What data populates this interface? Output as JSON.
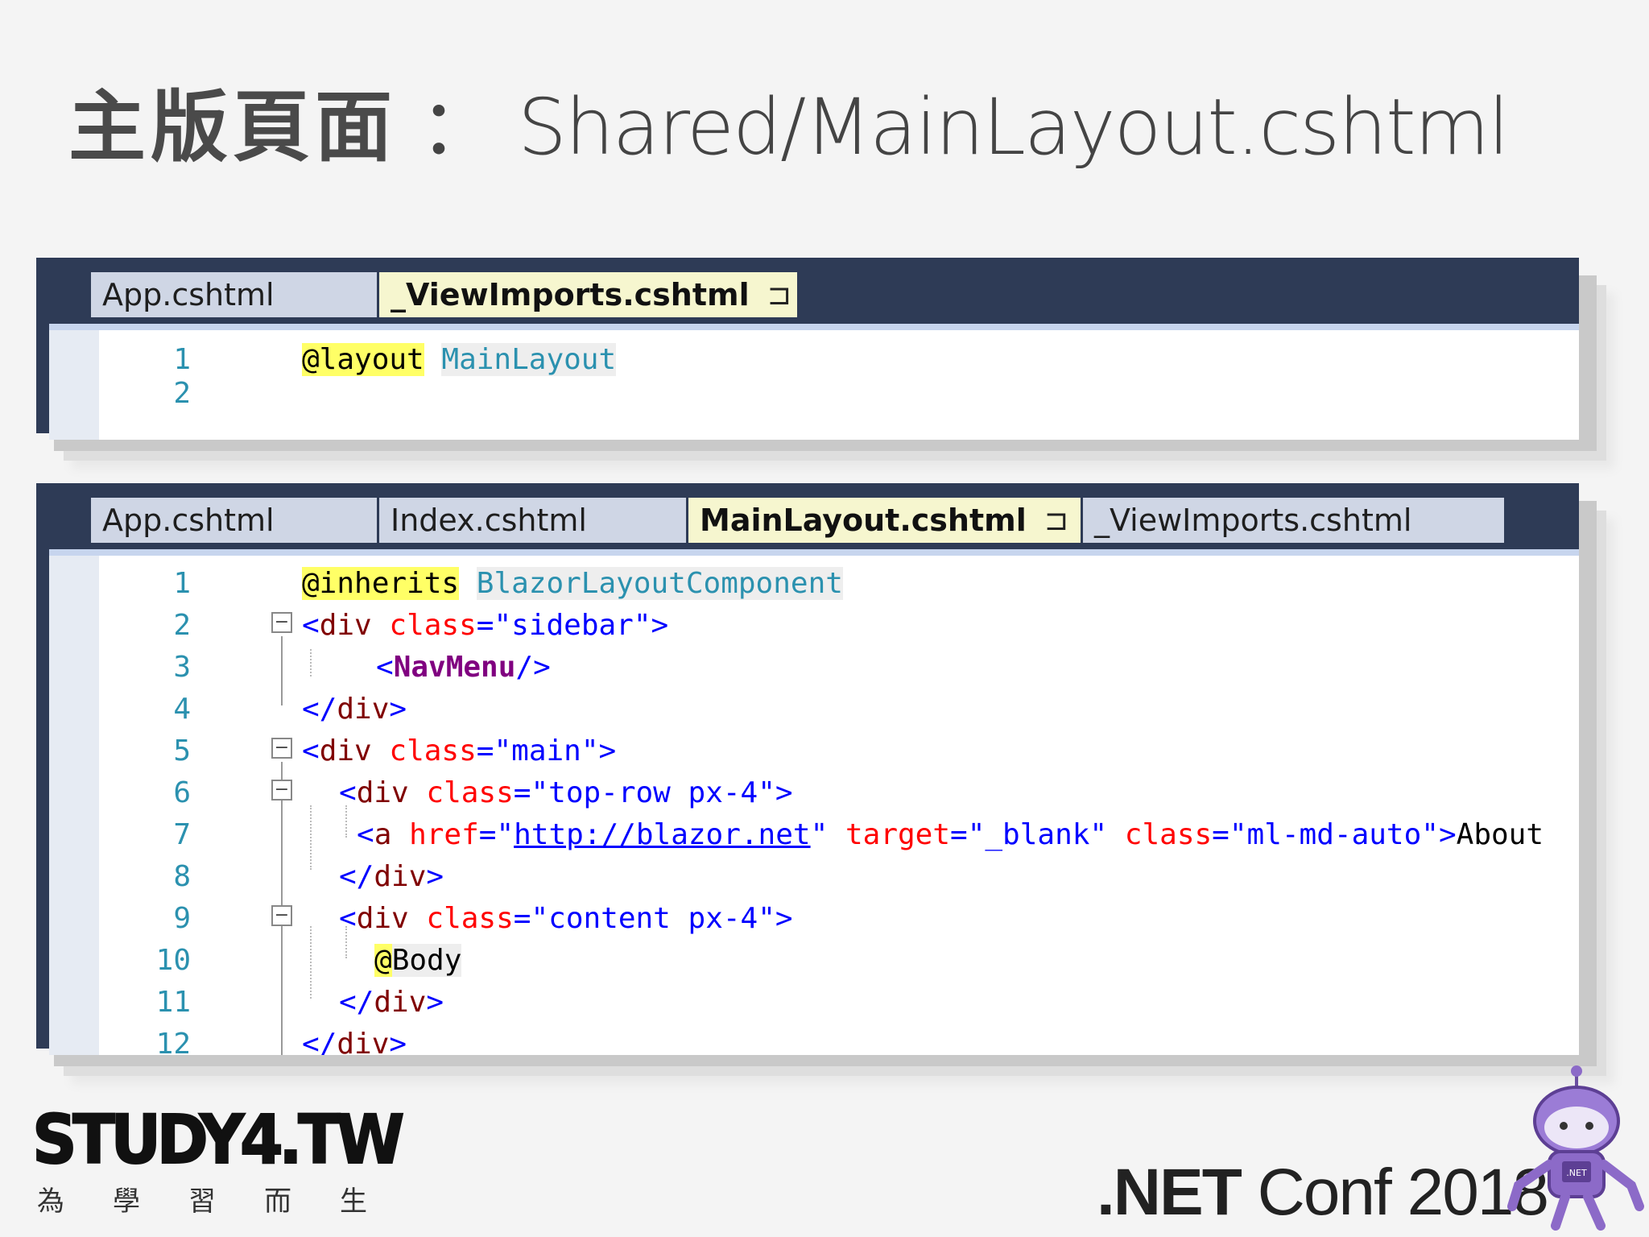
{
  "slide": {
    "title_cjk": "主版頁面",
    "title_sep": "：",
    "title_path": "Shared/MainLayout.cshtml"
  },
  "panel1": {
    "tabs": [
      {
        "label": "App.cshtml",
        "active": false
      },
      {
        "label": "_ViewImports.cshtml",
        "active": true,
        "pin": "⊐",
        "close": "✕"
      }
    ],
    "lines": [
      {
        "num": "1",
        "directive": "@layout",
        "value": "MainLayout"
      },
      {
        "num": "2"
      }
    ]
  },
  "panel2": {
    "tabs": [
      {
        "label": "App.cshtml",
        "active": false
      },
      {
        "label": "Index.cshtml",
        "active": false
      },
      {
        "label": "MainLayout.cshtml",
        "active": true,
        "pin": "⊐",
        "close": "✕"
      },
      {
        "label": "_ViewImports.cshtml",
        "active": false
      }
    ],
    "lines": [
      {
        "num": "1"
      },
      {
        "num": "2"
      },
      {
        "num": "3"
      },
      {
        "num": "4"
      },
      {
        "num": "5"
      },
      {
        "num": "6"
      },
      {
        "num": "7"
      },
      {
        "num": "8"
      },
      {
        "num": "9"
      },
      {
        "num": "10"
      },
      {
        "num": "11"
      },
      {
        "num": "12"
      }
    ],
    "code": {
      "l1_directive": "@inherits",
      "l1_type": "BlazorLayoutComponent",
      "l2_open": "<",
      "l2_tag": "div",
      "l2_attr": "class",
      "l2_eq": "=\"",
      "l2_val": "sidebar",
      "l2_end": "\">",
      "l3_open": "<",
      "l3_comp": "NavMenu",
      "l3_end": " />",
      "l4_close": "</",
      "l4_tag": "div",
      "l4_end": ">",
      "l5_open": "<",
      "l5_tag": "div",
      "l5_attr": "class",
      "l5_eq": "=\"",
      "l5_val": "main",
      "l5_end": "\">",
      "l6_open": "<",
      "l6_tag": "div",
      "l6_attr": "class",
      "l6_eq": "=\"",
      "l6_val": "top-row px-4",
      "l6_end": "\">",
      "l7_open": "<",
      "l7_tag": "a",
      "l7_attr1": "href",
      "l7_eq1": "=\"",
      "l7_url": "http://blazor.net",
      "l7_q1": "\"",
      "l7_attr2": "target",
      "l7_eq2": "=\"",
      "l7_val2": "_blank",
      "l7_q2": "\"",
      "l7_attr3": "class",
      "l7_eq3": "=\"",
      "l7_val3": "ml-md-auto",
      "l7_end": "\">",
      "l7_text": "About",
      "l8_close": "</",
      "l8_tag": "div",
      "l8_end": ">",
      "l9_open": "<",
      "l9_tag": "div",
      "l9_attr": "class",
      "l9_eq": "=\"",
      "l9_val": "content px-4",
      "l9_end": "\">",
      "l10_at": "@",
      "l10_body": "Body",
      "l11_close": "</",
      "l11_tag": "div",
      "l11_end": ">",
      "l12_close": "</",
      "l12_tag": "div",
      "l12_end": ">"
    },
    "fold_glyph": "−"
  },
  "footer": {
    "study_logo": "STUDY4.TW",
    "study_sub": [
      "為",
      "學",
      "習",
      "而",
      "生"
    ],
    "conf_net": ".NET",
    "conf_rest": "Conf 2018",
    "mascot_badge": ".NET"
  },
  "colors": {
    "frame": "#2e3b56",
    "tab_inactive": "#cfd6e5",
    "tab_active": "#f6f6cf",
    "line_number": "#2b91af",
    "highlight": "#ffff66"
  }
}
